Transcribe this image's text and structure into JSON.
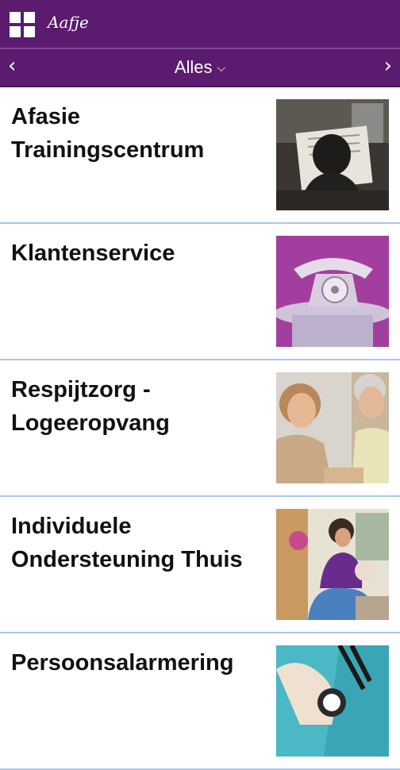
{
  "header": {
    "logo_text": "Aafje",
    "grid_icon": "grid-icon",
    "brand_color": "#5b1b6e"
  },
  "filter": {
    "label": "Alles",
    "prev_icon": "‹",
    "next_icon": "›",
    "dropdown_icon": "⌄"
  },
  "items": [
    {
      "title": "Afasie Trainingscentrum",
      "image": "person-reading-newspaper"
    },
    {
      "title": "Klantenservice",
      "image": "telephone"
    },
    {
      "title": "Respijtzorg - Logeeropvang",
      "image": "two-women-talking"
    },
    {
      "title": "Individuele Ondersteuning Thuis",
      "image": "caregiver-with-elderly"
    },
    {
      "title": "Persoonsalarmering",
      "image": "alarm-button"
    }
  ],
  "colors": {
    "separator": "#aac8e6",
    "text": "#111111"
  }
}
